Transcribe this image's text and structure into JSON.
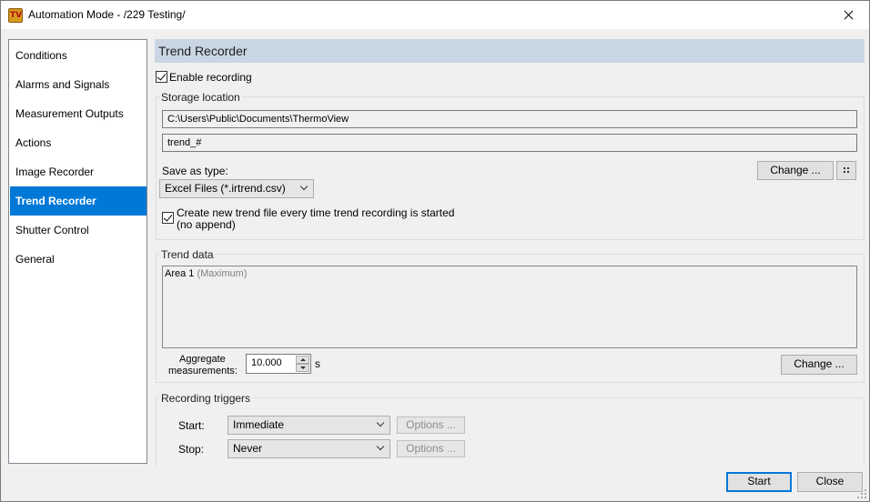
{
  "window": {
    "title": "Automation Mode - /229 Testing/",
    "icon": "thermoview-app-icon",
    "icon_text": "TV"
  },
  "nav": {
    "items": [
      {
        "label": "Conditions"
      },
      {
        "label": "Alarms and Signals"
      },
      {
        "label": "Measurement Outputs"
      },
      {
        "label": "Actions"
      },
      {
        "label": "Image Recorder"
      },
      {
        "label": "Trend Recorder",
        "selected": true
      },
      {
        "label": "Shutter Control"
      },
      {
        "label": "General"
      }
    ]
  },
  "panel": {
    "title": "Trend Recorder",
    "enable_recording": {
      "label": "Enable recording",
      "checked": true
    },
    "storage": {
      "title": "Storage location",
      "path": "C:\\Users\\Public\\Documents\\ThermoView",
      "filename": "trend_#",
      "save_as_label": "Save as type:",
      "save_as_value": "Excel Files (*.irtrend.csv)",
      "change_label": "Change ...",
      "new_file": {
        "label_line1": "Create new trend file every time trend recording is started",
        "label_line2": "(no append)",
        "checked": true
      }
    },
    "trend_data": {
      "title": "Trend data",
      "items": [
        {
          "name": "Area 1",
          "detail": "(Maximum)"
        }
      ],
      "aggregate_label_line1": "Aggregate",
      "aggregate_label_line2": "measurements:",
      "aggregate_value": "10.000",
      "aggregate_unit": "s",
      "change_label": "Change ..."
    },
    "triggers": {
      "title": "Recording triggers",
      "start_label": "Start:",
      "start_value": "Immediate",
      "stop_label": "Stop:",
      "stop_value": "Never",
      "options_label": "Options ..."
    }
  },
  "footer": {
    "start_label": "Start",
    "close_label": "Close"
  },
  "colors": {
    "accent": "#0078d7",
    "header_bg": "#c9d6e3"
  }
}
